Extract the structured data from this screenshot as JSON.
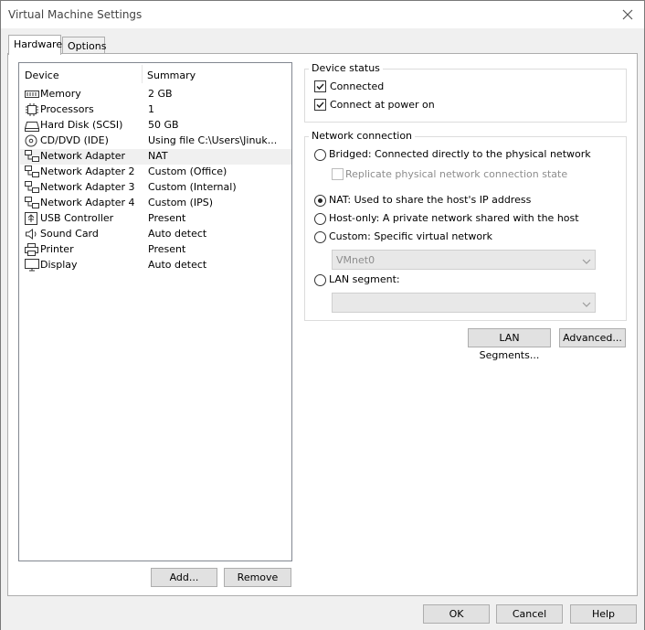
{
  "window": {
    "title": "Virtual Machine Settings",
    "close_icon": "close-icon"
  },
  "tabs": [
    {
      "label": "Hardware",
      "active": true
    },
    {
      "label": "Options",
      "active": false
    }
  ],
  "device_list": {
    "headers": {
      "device": "Device",
      "summary": "Summary"
    },
    "rows": [
      {
        "device": "Memory",
        "summary": "2 GB",
        "icon": "memory-icon",
        "selected": false
      },
      {
        "device": "Processors",
        "summary": "1",
        "icon": "processor-icon",
        "selected": false
      },
      {
        "device": "Hard Disk (SCSI)",
        "summary": "50 GB",
        "icon": "hard-disk-icon",
        "selected": false
      },
      {
        "device": "CD/DVD (IDE)",
        "summary": "Using file C:\\Users\\Jinuk...",
        "icon": "cd-dvd-icon",
        "selected": false
      },
      {
        "device": "Network Adapter",
        "summary": "NAT",
        "icon": "network-adapter-icon",
        "selected": true
      },
      {
        "device": "Network Adapter 2",
        "summary": "Custom (Office)",
        "icon": "network-adapter-icon",
        "selected": false
      },
      {
        "device": "Network Adapter 3",
        "summary": "Custom (Internal)",
        "icon": "network-adapter-icon",
        "selected": false
      },
      {
        "device": "Network Adapter 4",
        "summary": "Custom (IPS)",
        "icon": "network-adapter-icon",
        "selected": false
      },
      {
        "device": "USB Controller",
        "summary": "Present",
        "icon": "usb-icon",
        "selected": false
      },
      {
        "device": "Sound Card",
        "summary": "Auto detect",
        "icon": "speaker-icon",
        "selected": false
      },
      {
        "device": "Printer",
        "summary": "Present",
        "icon": "printer-icon",
        "selected": false
      },
      {
        "device": "Display",
        "summary": "Auto detect",
        "icon": "display-icon",
        "selected": false
      }
    ]
  },
  "list_buttons": {
    "add": "Add...",
    "remove": "Remove"
  },
  "device_status": {
    "label": "Device status",
    "connected": {
      "label": "Connected",
      "checked": true
    },
    "connect_at_power_on": {
      "label": "Connect at power on",
      "checked": true
    }
  },
  "network_connection": {
    "label": "Network connection",
    "bridged": {
      "label": "Bridged: Connected directly to the physical network",
      "selected": false
    },
    "replicate": {
      "label": "Replicate physical network connection state",
      "checked": false,
      "enabled": false
    },
    "nat": {
      "label": "NAT: Used to share the host's IP address",
      "selected": true
    },
    "host_only": {
      "label": "Host-only: A private network shared with the host",
      "selected": false
    },
    "custom": {
      "label": "Custom: Specific virtual network",
      "selected": false
    },
    "custom_network_value": "VMnet0",
    "lan_segment": {
      "label": "LAN segment:",
      "selected": false
    },
    "lan_segment_value": ""
  },
  "network_buttons": {
    "lan_segments": "LAN Segments...",
    "advanced": "Advanced..."
  },
  "dialog_buttons": {
    "ok": "OK",
    "cancel": "Cancel",
    "help": "Help"
  },
  "colors": {
    "selected_row": "#f0f0f0",
    "button_face": "#e1e1e1",
    "panel": "#ffffff"
  }
}
